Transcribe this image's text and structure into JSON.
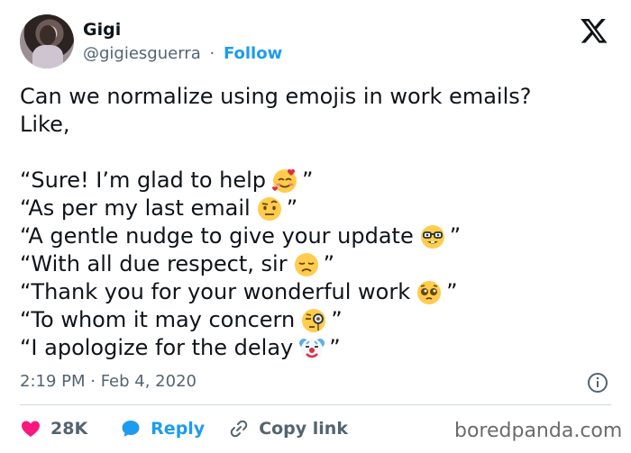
{
  "author": {
    "name": "Gigi",
    "handle": "@gigiesguerra",
    "separator": "·",
    "follow_label": "Follow"
  },
  "tweet": {
    "lines": [
      "Can we normalize using emojis in work emails?",
      "Like,",
      "",
      "“Sure! I’m glad to help",
      "“As per my last email",
      "“A gentle nudge to give your update",
      "“With all due respect, sir",
      "“Thank you for your wonderful work",
      "“To whom it may concern",
      "“I apologize for the delay"
    ],
    "closing_quote": "”",
    "emojis": [
      "smiling-face-with-hearts",
      "face-with-raised-eyebrow",
      "nerd-face",
      "disappointed-face",
      "pleading-face",
      "face-with-monocle",
      "clown-face"
    ]
  },
  "timestamp": "2:19 PM · Feb 4, 2020",
  "actions": {
    "likes_count": "28K",
    "reply_label": "Reply",
    "copy_link_label": "Copy link"
  },
  "watermark": "boredpanda.com",
  "colors": {
    "accent": "#1d9bf0",
    "like": "#f91880",
    "text": "#0f1419",
    "muted": "#536471"
  }
}
